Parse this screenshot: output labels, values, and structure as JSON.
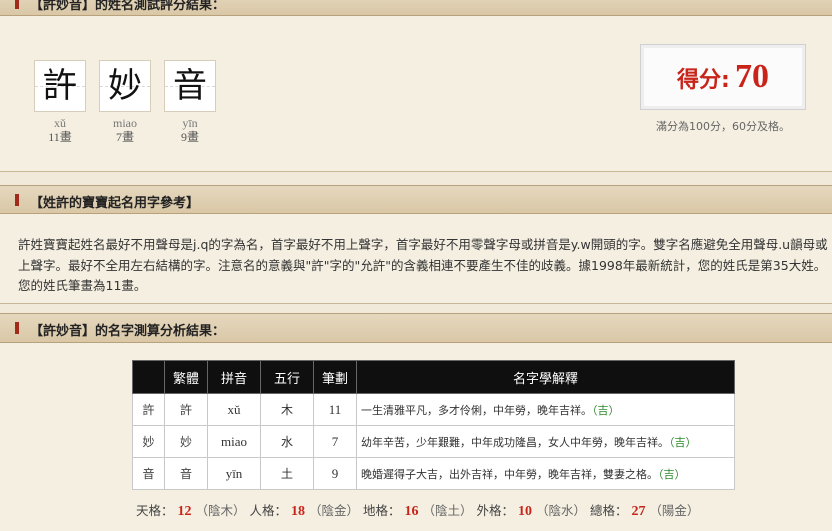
{
  "sections": {
    "result_title": "【許妙音】的姓名測試評分結果：",
    "reference_title": "【姓許的寶寶起名用字參考】",
    "analysis_title": "【許妙音】的名字測算分析結果："
  },
  "name_chars": [
    {
      "char": "許",
      "pinyin": "xǔ",
      "strokes": "11畫"
    },
    {
      "char": "妙",
      "pinyin": "miao",
      "strokes": "7畫"
    },
    {
      "char": "音",
      "pinyin": "yīn",
      "strokes": "9畫"
    }
  ],
  "score": {
    "label": "得分:",
    "value": "70",
    "note": "滿分為100分，60分及格。"
  },
  "reference_text": "許姓寶寶起姓名最好不用聲母是j.q的字為名，首字最好不用上聲字，首字最好不用零聲字母或拼音是y.w開頭的字。雙字名應避免全用聲母.u韻母或上聲字。最好不全用左右結構的字。注意名的意義與\"許\"字的\"允許\"的含義相連不要產生不佳的歧義。據1998年最新統計，您的姓氏是第35大姓。您的姓氏筆畫為11畫。",
  "table": {
    "headers": [
      "",
      "繁體",
      "拼音",
      "五行",
      "筆劃",
      "名字學解釋"
    ],
    "rows": [
      {
        "char": "許",
        "trad": "許",
        "pinyin": "xǔ",
        "element": "木",
        "strokes": "11",
        "desc": "一生清雅平凡，多才伶俐，中年勞，晚年吉祥。",
        "luck": "（吉）"
      },
      {
        "char": "妙",
        "trad": "妙",
        "pinyin": "miao",
        "element": "水",
        "strokes": "7",
        "desc": "幼年辛苦，少年艱難，中年成功隆昌，女人中年勞，晚年吉祥。",
        "luck": "（吉）"
      },
      {
        "char": "音",
        "trad": "音",
        "pinyin": "yīn",
        "element": "土",
        "strokes": "9",
        "desc": "晚婚遲得子大吉，出外吉祥，中年勞，晚年吉祥，雙妻之格。",
        "luck": "（吉）"
      }
    ]
  },
  "grids": [
    {
      "label": "天格：",
      "value": "12",
      "element": "（陰木）"
    },
    {
      "label": "人格：",
      "value": "18",
      "element": "（陰金）"
    },
    {
      "label": "地格：",
      "value": "16",
      "element": "（陰土）"
    },
    {
      "label": "外格：",
      "value": "10",
      "element": "（陰水）"
    },
    {
      "label": "總格：",
      "value": "27",
      "element": "（陽金）"
    }
  ]
}
